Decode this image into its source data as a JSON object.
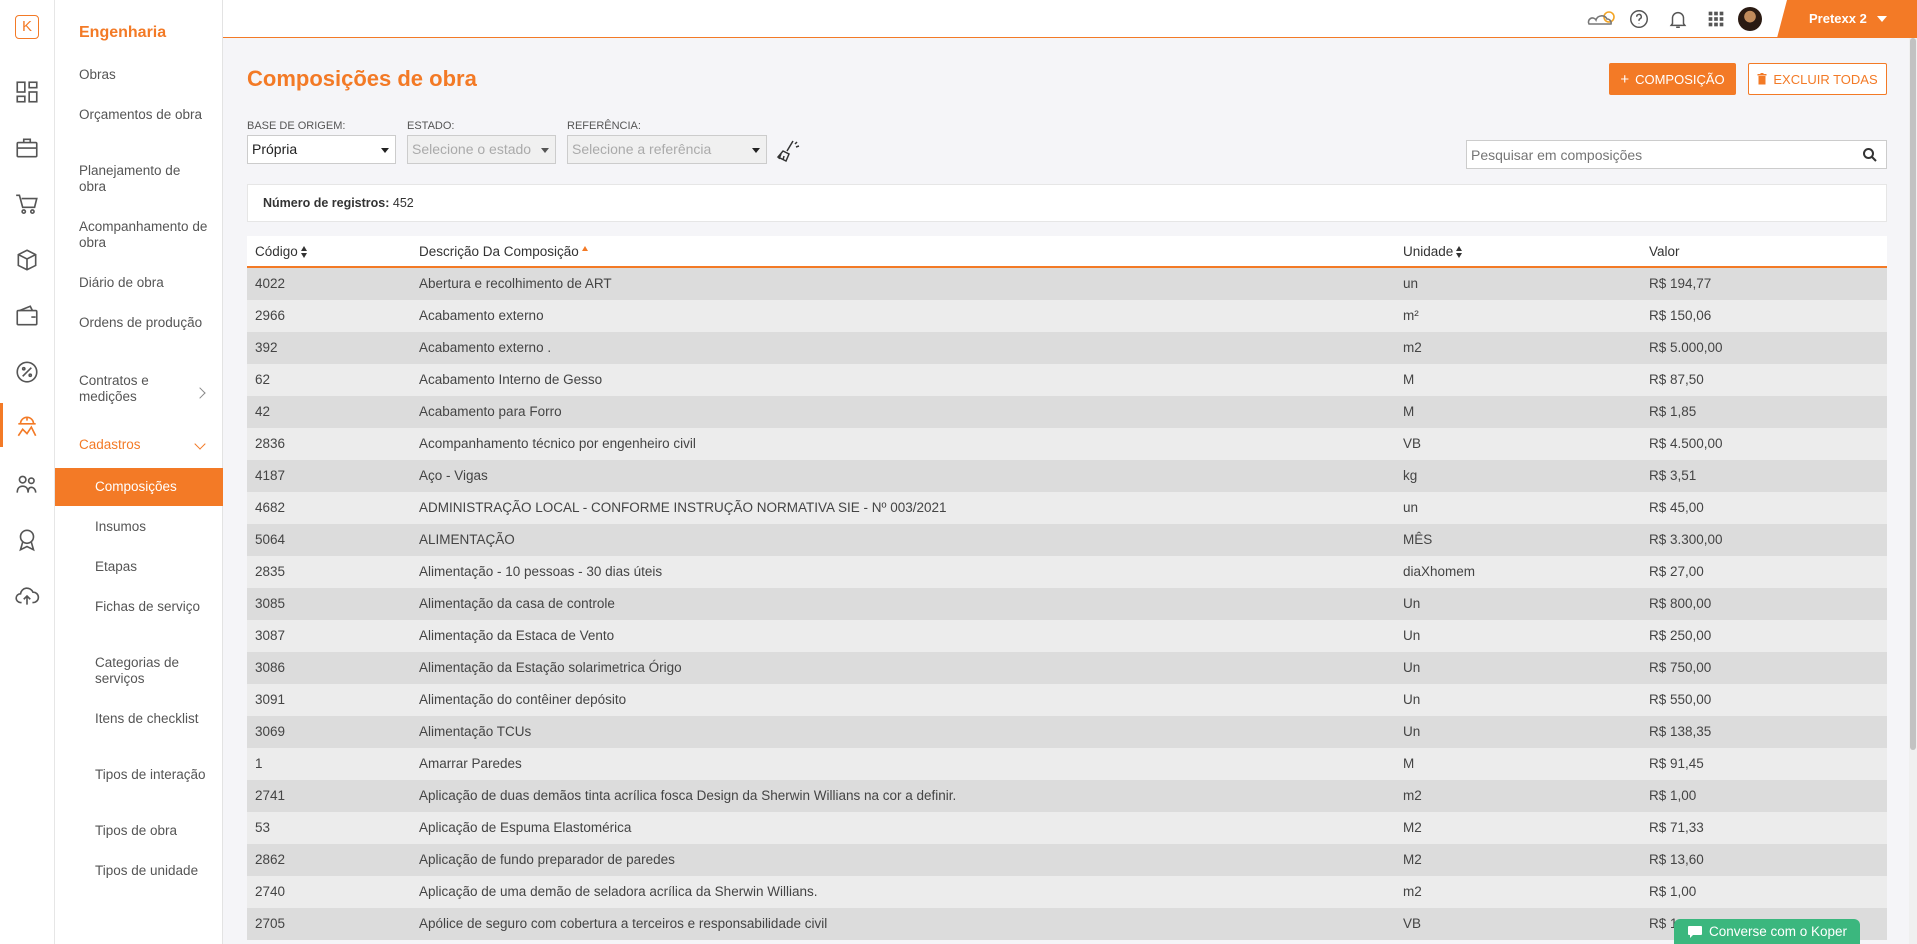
{
  "rail": {
    "logo": "K",
    "icons": [
      "dashboard-icon",
      "briefcase-icon",
      "cart-icon",
      "boxes-icon",
      "wallet-icon",
      "percent-icon",
      "engineering-icon",
      "team-icon",
      "badge-icon",
      "cloud-upload-icon"
    ]
  },
  "sidebar": {
    "section_title": "Engenharia",
    "items": [
      {
        "label": "Obras"
      },
      {
        "label": "Orçamentos de obra"
      },
      {
        "label": "Planejamento de obra"
      },
      {
        "label": "Acompanhamento de obra"
      },
      {
        "label": "Diário de obra"
      },
      {
        "label": "Ordens de produção"
      },
      {
        "label": "Contratos e medições"
      },
      {
        "label": "Cadastros"
      }
    ],
    "sub_items": [
      {
        "label": "Composições",
        "active": true
      },
      {
        "label": "Insumos"
      },
      {
        "label": "Etapas"
      },
      {
        "label": "Fichas de serviço"
      },
      {
        "label": "Categorias de serviços"
      },
      {
        "label": "Itens de checklist"
      },
      {
        "label": "Tipos de interação"
      },
      {
        "label": "Tipos de obra"
      },
      {
        "label": "Tipos de unidade"
      }
    ]
  },
  "topbar": {
    "icons": [
      "weather-icon",
      "help-icon",
      "bell-icon",
      "apps-grid-icon"
    ],
    "user_name": "Pretexx 2"
  },
  "page": {
    "title": "Composições de obra",
    "add_button": "COMPOSIÇÃO",
    "delete_all_button": "EXCLUIR TODAS"
  },
  "filters": {
    "base_label": "BASE DE ORIGEM:",
    "base_value": "Própria",
    "estado_label": "ESTADO:",
    "estado_placeholder": "Selecione o estado",
    "ref_label": "REFERÊNCIA:",
    "ref_placeholder": "Selecione a referência",
    "search_placeholder": "Pesquisar em composições"
  },
  "records": {
    "label": "Número de registros:",
    "count": "452"
  },
  "table": {
    "headers": {
      "code": "Código",
      "desc": "Descrição Da Composição",
      "unit": "Unidade",
      "value": "Valor"
    },
    "rows": [
      {
        "code": "4022",
        "desc": "Abertura e recolhimento de ART",
        "unit": "un",
        "value": "R$ 194,77"
      },
      {
        "code": "2966",
        "desc": "Acabamento externo",
        "unit": "m²",
        "value": "R$ 150,06"
      },
      {
        "code": "392",
        "desc": "Acabamento externo .",
        "unit": "m2",
        "value": "R$ 5.000,00"
      },
      {
        "code": "62",
        "desc": "Acabamento Interno de Gesso",
        "unit": "M",
        "value": "R$ 87,50"
      },
      {
        "code": "42",
        "desc": "Acabamento para Forro",
        "unit": "M",
        "value": "R$ 1,85"
      },
      {
        "code": "2836",
        "desc": "Acompanhamento técnico por engenheiro civil",
        "unit": "VB",
        "value": "R$ 4.500,00"
      },
      {
        "code": "4187",
        "desc": "Aço - Vigas",
        "unit": "kg",
        "value": "R$ 3,51"
      },
      {
        "code": "4682",
        "desc": "ADMINISTRAÇÃO LOCAL - CONFORME INSTRUÇÃO NORMATIVA SIE - Nº 003/2021",
        "unit": "un",
        "value": "R$ 45,00"
      },
      {
        "code": "5064",
        "desc": "ALIMENTAÇÃO",
        "unit": "MÊS",
        "value": "R$ 3.300,00"
      },
      {
        "code": "2835",
        "desc": "Alimentação - 10 pessoas - 30 dias úteis",
        "unit": "diaXhomem",
        "value": "R$ 27,00"
      },
      {
        "code": "3085",
        "desc": "Alimentação da casa de controle",
        "unit": "Un",
        "value": "R$ 800,00"
      },
      {
        "code": "3087",
        "desc": "Alimentação da Estaca de Vento",
        "unit": "Un",
        "value": "R$ 250,00"
      },
      {
        "code": "3086",
        "desc": "Alimentação da Estação solarimetrica Órigo",
        "unit": "Un",
        "value": "R$ 750,00"
      },
      {
        "code": "3091",
        "desc": "Alimentação do contêiner depósito",
        "unit": "Un",
        "value": "R$ 550,00"
      },
      {
        "code": "3069",
        "desc": "Alimentação TCUs",
        "unit": "Un",
        "value": "R$ 138,35"
      },
      {
        "code": "1",
        "desc": "Amarrar Paredes",
        "unit": "M",
        "value": "R$ 91,45"
      },
      {
        "code": "2741",
        "desc": "Aplicação de duas demãos tinta acrílica fosca Design da Sherwin Willians na cor a definir.",
        "unit": "m2",
        "value": "R$ 1,00"
      },
      {
        "code": "53",
        "desc": "Aplicação de Espuma Elastomérica",
        "unit": "M2",
        "value": "R$ 71,33"
      },
      {
        "code": "2862",
        "desc": "Aplicação de fundo preparador de paredes",
        "unit": "M2",
        "value": "R$ 13,60"
      },
      {
        "code": "2740",
        "desc": "Aplicação de uma demão de seladora acrílica da Sherwin Willians.",
        "unit": "m2",
        "value": "R$ 1,00"
      },
      {
        "code": "2705",
        "desc": "Apólice de seguro com cobertura a terceiros e responsabilidade civil",
        "unit": "VB",
        "value": "R$ 1"
      }
    ]
  },
  "chat": {
    "label": "Converse com o Koper"
  },
  "colors": {
    "accent": "#f37a26",
    "chat": "#3bb77e"
  }
}
